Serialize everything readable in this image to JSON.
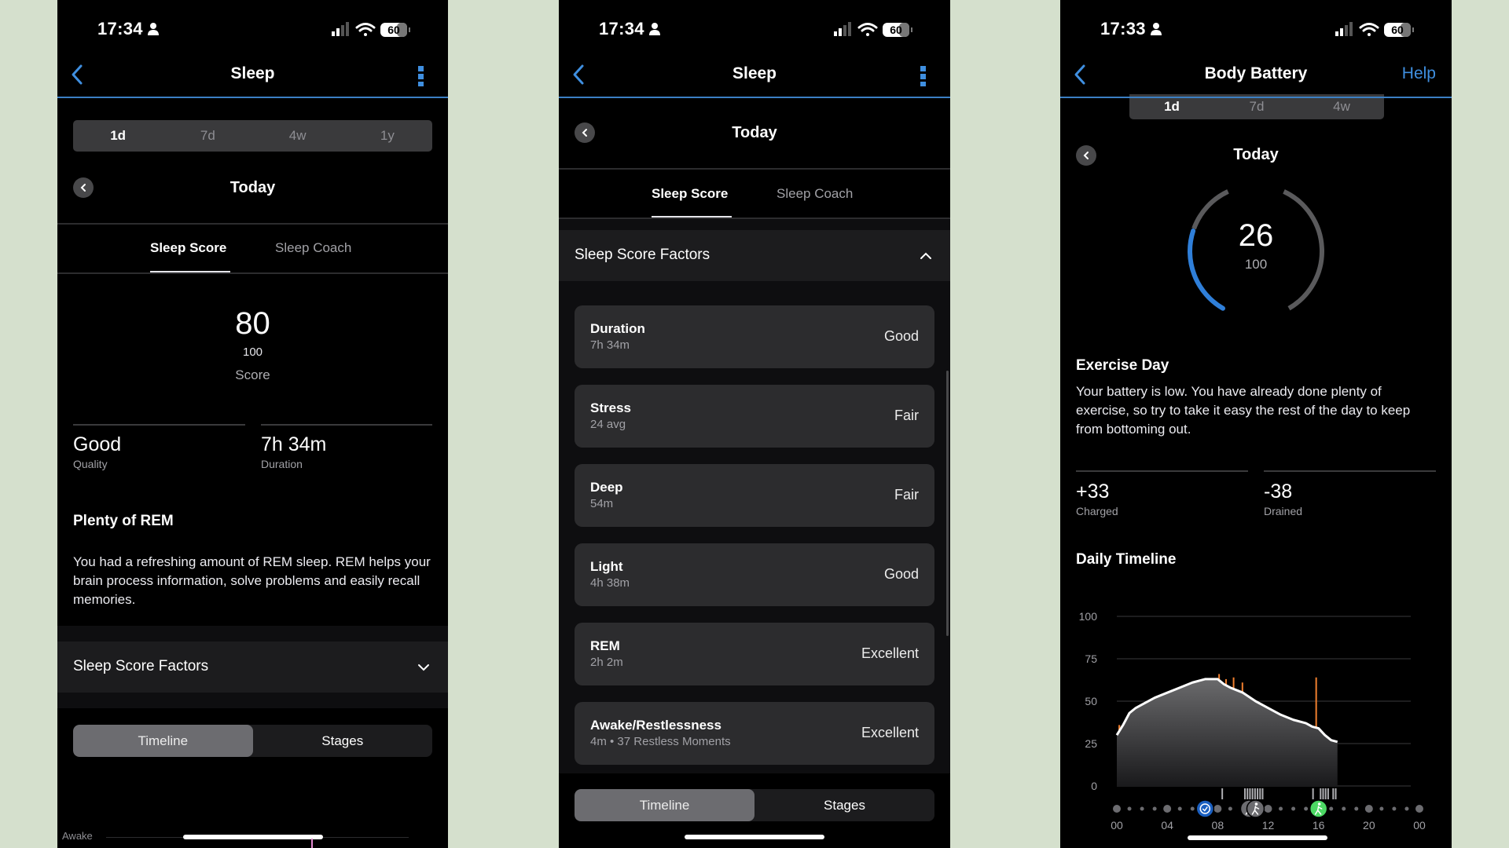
{
  "status_bar": {
    "phone1_time": "17:34",
    "phone2_time": "17:34",
    "phone3_time": "17:33",
    "battery": "60"
  },
  "colors": {
    "accent_blue": "#3f8fe0",
    "background": "#d5e0cd",
    "rest_blue": "#2f7fd9",
    "stress_orange": "#f07f2e",
    "activity_green": "#4cd964"
  },
  "sleep_screen_1": {
    "title": "Sleep",
    "ranges": [
      "1d",
      "7d",
      "4w",
      "1y"
    ],
    "selected_range": "1d",
    "date_label": "Today",
    "tabs": [
      "Sleep Score",
      "Sleep Coach"
    ],
    "active_tab": "Sleep Score",
    "score": "80",
    "score_max": "100",
    "score_label": "Score",
    "quality_value": "Good",
    "quality_label": "Quality",
    "duration_value": "7h 34m",
    "duration_label": "Duration",
    "insight_title": "Plenty of REM",
    "insight_text": "You had a refreshing amount of REM sleep. REM helps your brain process information, solve problems and easily recall memories.",
    "factors_title": "Sleep Score Factors",
    "view_toggle": [
      "Timeline",
      "Stages"
    ],
    "active_view": "Timeline",
    "chart_row_label": "Awake"
  },
  "sleep_screen_2": {
    "title": "Sleep",
    "date_label": "Today",
    "tabs": [
      "Sleep Score",
      "Sleep Coach"
    ],
    "active_tab": "Sleep Score",
    "factors_title": "Sleep Score Factors",
    "factors": [
      {
        "name": "Duration",
        "detail": "7h 34m",
        "rating": "Good"
      },
      {
        "name": "Stress",
        "detail": "24 avg",
        "rating": "Fair"
      },
      {
        "name": "Deep",
        "detail": "54m",
        "rating": "Fair"
      },
      {
        "name": "Light",
        "detail": "4h 38m",
        "rating": "Good"
      },
      {
        "name": "REM",
        "detail": "2h 2m",
        "rating": "Excellent"
      },
      {
        "name": "Awake/Restlessness",
        "detail": "4m • 37 Restless Moments",
        "rating": "Excellent"
      }
    ],
    "view_toggle": [
      "Timeline",
      "Stages"
    ],
    "active_view": "Timeline"
  },
  "body_battery_screen": {
    "title": "Body Battery",
    "help_label": "Help",
    "ranges": [
      "1d",
      "7d",
      "4w"
    ],
    "selected_range": "1d",
    "date_label": "Today",
    "gauge_value": "26",
    "gauge_max": "100",
    "gauge_fraction": 0.26,
    "insight_title": "Exercise Day",
    "insight_text": "Your battery is low. You have already done plenty of exercise, so try to take it easy the rest of the day to keep from bottoming out.",
    "charged_value": "+33",
    "charged_label": "Charged",
    "drained_value": "-38",
    "drained_label": "Drained",
    "timeline_title": "Daily Timeline"
  },
  "chart_data": {
    "type": "area",
    "title": "Daily Timeline",
    "xlabel": "",
    "ylabel": "",
    "ylim": [
      0,
      100
    ],
    "xlim": [
      0,
      24
    ],
    "y_ticks": [
      "100",
      "75",
      "50",
      "25",
      "0"
    ],
    "x_ticks": [
      "00",
      "04",
      "08",
      "12",
      "16",
      "20",
      "00"
    ],
    "grid": true,
    "series": [
      {
        "name": "Body Battery",
        "x": [
          0,
          0.5,
          1,
          1.5,
          2,
          3,
          4,
          5,
          6,
          7,
          7.5,
          8,
          8.5,
          9,
          10,
          11,
          12,
          13,
          14,
          15,
          15.5,
          16,
          16.5,
          17,
          17.5
        ],
        "values": [
          30,
          36,
          43,
          46,
          48,
          52,
          55,
          58,
          61,
          63,
          63,
          63,
          60,
          58,
          55,
          50,
          46,
          42,
          39,
          37,
          35,
          34,
          30,
          27,
          26
        ]
      }
    ],
    "annotations": {
      "events": [
        {
          "hour": 7,
          "type": "sleep-end",
          "icon": "clock-check-icon"
        },
        {
          "hour": 10.5,
          "type": "walk",
          "icon": "walk-icon"
        },
        {
          "hour": 11,
          "type": "walk",
          "icon": "walk-icon"
        },
        {
          "hour": 16,
          "type": "run",
          "icon": "run-icon"
        }
      ]
    }
  }
}
